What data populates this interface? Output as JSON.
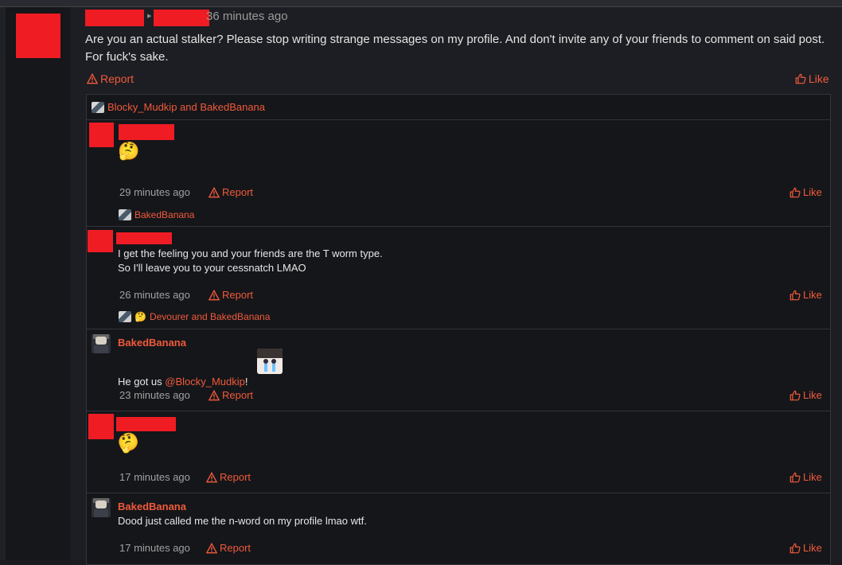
{
  "status": {
    "time": "36 minutes ago",
    "text": "Are you an actual stalker? Please stop writing strange messages on my profile. And don't invite any of your friends to comment on said post. For fuck's sake.",
    "report_label": "Report",
    "like_label": "Like",
    "likers": "Blocky_Mudkip and BakedBanana"
  },
  "comments": [
    {
      "author": "",
      "text": "",
      "emoji": "🤔",
      "time": "29 minutes ago",
      "report": "Report",
      "like": "Like",
      "likers": "BakedBanana"
    },
    {
      "author": "",
      "text": "I get the feeling you and your friends are the T worm type.\nSo I'll leave you to your cessnatch LMAO",
      "time": "26 minutes ago",
      "report": "Report",
      "like": "Like",
      "likers": "Devourer and BakedBanana"
    },
    {
      "author": "BakedBanana",
      "text_prefix": "He got us ",
      "mention": "@Blocky_Mudkip",
      "text_suffix": "!",
      "time": "23 minutes ago",
      "report": "Report",
      "like": "Like"
    },
    {
      "author": "",
      "emoji": "🤔",
      "time": "17 minutes ago",
      "report": "Report",
      "like": "Like"
    },
    {
      "author": "BakedBanana",
      "text": "Dood just called me the n-word on my profile lmao wtf.",
      "time": "17 minutes ago",
      "report": "Report",
      "like": "Like"
    }
  ],
  "colors": {
    "accent": "#f05a3a",
    "redaction": "#ef1c24",
    "background": "#1d1e23"
  },
  "icons": {
    "report": "warning-triangle-icon",
    "like": "thumbs-up-icon"
  }
}
